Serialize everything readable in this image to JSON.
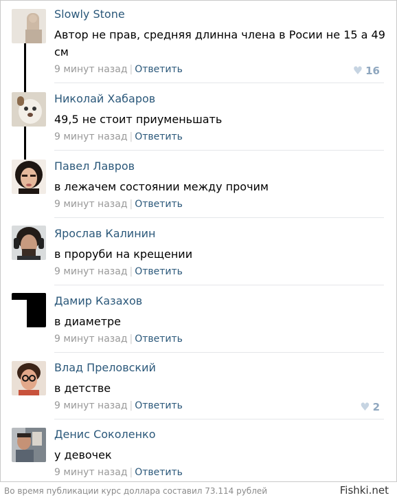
{
  "comments": [
    {
      "author": "Slowly Stone",
      "text": "Автор не прав, средняя длинна члена в Росии не 15 а 49 см",
      "time": "9 минут назад",
      "reply": "Ответить",
      "likes": "16"
    },
    {
      "author": "Николай Хабаров",
      "text": "49,5 не стоит приуменьшать",
      "time": "9 минут назад",
      "reply": "Ответить",
      "likes": ""
    },
    {
      "author": "Павел Лавров",
      "text": "в лежачем состоянии между прочим",
      "time": "9 минут назад",
      "reply": "Ответить",
      "likes": ""
    },
    {
      "author": "Ярослав Калинин",
      "text": "в проруби на крещении",
      "time": "9 минут назад",
      "reply": "Ответить",
      "likes": ""
    },
    {
      "author": "Дамир Казахов",
      "text": "в диаметре",
      "time": "9 минут назад",
      "reply": "Ответить",
      "likes": ""
    },
    {
      "author": "Влад Преловский",
      "text": "в детстве",
      "time": "9 минут назад",
      "reply": "Ответить",
      "likes": "2"
    },
    {
      "author": "Денис Соколенко",
      "text": "у девочек",
      "time": "9 минут назад",
      "reply": "Ответить",
      "likes": ""
    }
  ],
  "footer": {
    "note": "Во время публикации курс доллара составил 73.114 рублей",
    "brand": "Fishki.net"
  },
  "colors": {
    "author": "#2b587a",
    "meta": "#999999",
    "like": "#8fa7bf"
  }
}
